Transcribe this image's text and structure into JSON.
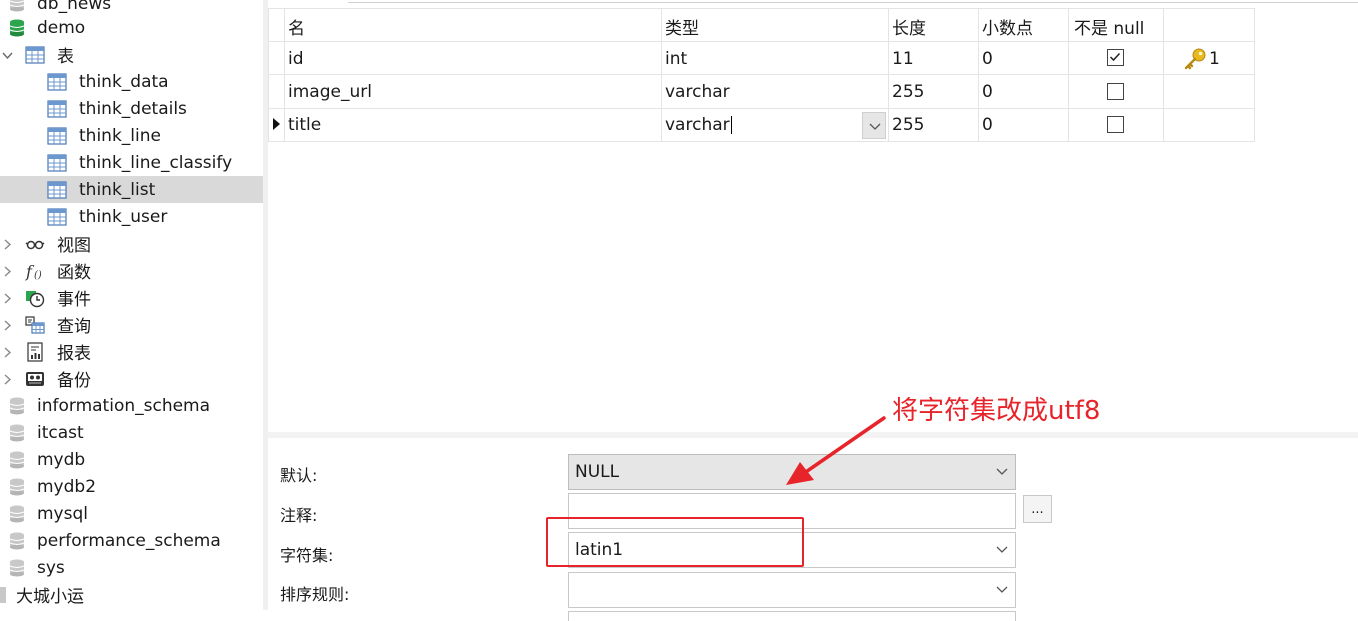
{
  "tree": {
    "items": [
      {
        "label": "db_news",
        "kind": "db-gray"
      },
      {
        "label": "demo",
        "kind": "db-green"
      },
      {
        "label": "表",
        "kind": "tables-folder"
      },
      {
        "label": "think_data",
        "kind": "table"
      },
      {
        "label": "think_details",
        "kind": "table"
      },
      {
        "label": "think_line",
        "kind": "table"
      },
      {
        "label": "think_line_classify",
        "kind": "table"
      },
      {
        "label": "think_list",
        "kind": "table",
        "selected": true
      },
      {
        "label": "think_user",
        "kind": "table"
      },
      {
        "label": "视图",
        "kind": "views"
      },
      {
        "label": "函数",
        "kind": "functions"
      },
      {
        "label": "事件",
        "kind": "events"
      },
      {
        "label": "查询",
        "kind": "queries"
      },
      {
        "label": "报表",
        "kind": "reports"
      },
      {
        "label": "备份",
        "kind": "backups"
      },
      {
        "label": "information_schema",
        "kind": "db-gray"
      },
      {
        "label": "itcast",
        "kind": "db-gray"
      },
      {
        "label": "mydb",
        "kind": "db-gray"
      },
      {
        "label": "mydb2",
        "kind": "db-gray"
      },
      {
        "label": "mysql",
        "kind": "db-gray"
      },
      {
        "label": "performance_schema",
        "kind": "db-gray"
      },
      {
        "label": "sys",
        "kind": "db-gray"
      },
      {
        "label": "大城小运",
        "kind": "connection"
      }
    ]
  },
  "fields": {
    "headers": [
      "名",
      "类型",
      "长度",
      "小数点",
      "不是 null"
    ],
    "rows": [
      {
        "name": "id",
        "type": "int",
        "length": "11",
        "decimals": "0",
        "not_null": true,
        "key": "1"
      },
      {
        "name": "image_url",
        "type": "varchar",
        "length": "255",
        "decimals": "0",
        "not_null": false,
        "key": ""
      },
      {
        "name": "title",
        "type": "varchar",
        "length": "255",
        "decimals": "0",
        "not_null": false,
        "key": "",
        "current": true
      }
    ]
  },
  "props": {
    "default_label": "默认:",
    "default_value": "NULL",
    "comment_label": "注释:",
    "comment_value": "",
    "comment_button": "...",
    "charset_label": "字符集:",
    "charset_value": "latin1",
    "collation_label": "排序规则:",
    "collation_value": ""
  },
  "annotation": {
    "text": "将字符集改成utf8",
    "color": "#e8242b"
  }
}
